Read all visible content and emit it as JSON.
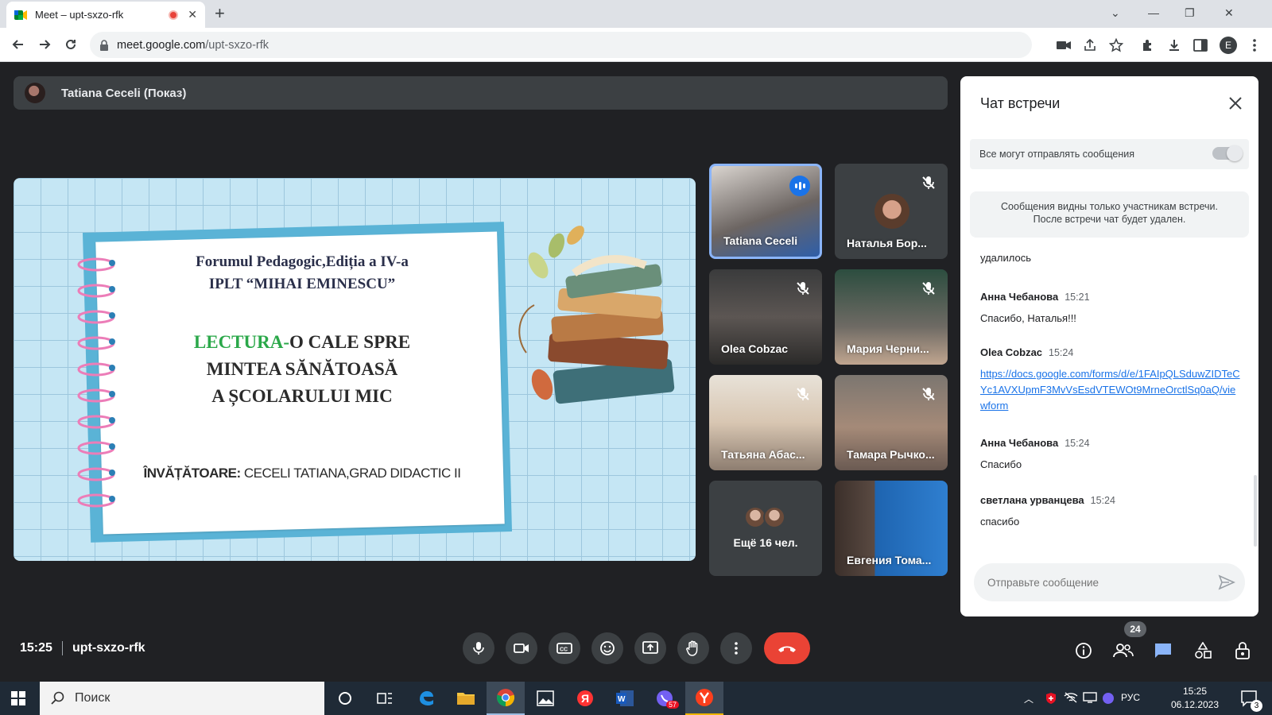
{
  "browser": {
    "tab_title": "Meet – upt-sxzo-rfk",
    "url_host": "meet.google.com",
    "url_path": "/upt-sxzo-rfk",
    "profile_initial": "E"
  },
  "meeting": {
    "presenter_label": "Tatiana Ceceli (Показ)",
    "time": "15:25",
    "code": "upt-sxzo-rfk",
    "participant_count": "24"
  },
  "slide": {
    "line1": "Forumul Pedagogic,Ediția a IV-a",
    "line2": "IPLT “MIHAI EMINESCU”",
    "title_green": "LECTURA-",
    "title_rest1": "O CALE SPRE",
    "title_line2": "MINTEA SĂNĂTOASĂ",
    "title_line3": "A ȘCOLARULUI MIC",
    "teacher_label": "ÎNVĂȚĂTOARE:",
    "teacher_name": "CECELI TATIANA,GRAD DIDACTIC II"
  },
  "participants": [
    {
      "name": "Tatiana Ceceli",
      "state": "speaking"
    },
    {
      "name": "Наталья Бор...",
      "state": "muted"
    },
    {
      "name": "Olea Cobzac",
      "state": "muted"
    },
    {
      "name": "Мария Черни...",
      "state": "muted"
    },
    {
      "name": "Татьяна Абас...",
      "state": "muted"
    },
    {
      "name": "Тамара Рычко...",
      "state": "muted"
    },
    {
      "name": "Ещё 16 чел.",
      "state": "overflow"
    },
    {
      "name": "Евгения Тома...",
      "state": "video"
    }
  ],
  "chat": {
    "title": "Чат встречи",
    "permission_label": "Все могут отправлять сообщения",
    "notice_line1": "Сообщения видны только участникам встречи.",
    "notice_line2": "После встречи чат будет удален.",
    "partial_text": "удалилось",
    "messages": [
      {
        "author": "Анна Чебанова",
        "time": "15:21",
        "text": "Спасибо, Наталья!!!"
      },
      {
        "author": "Olea Cobzac",
        "time": "15:24",
        "text": "https://docs.google.com/forms/d/e/1FAIpQLSduwZIDTeCYc1AVXUpmF3MvVsEsdVTEWOt9MrneOrctlSq0aQ/viewform"
      },
      {
        "author": "Анна Чебанова",
        "time": "15:24",
        "text": "Спасибо"
      },
      {
        "author": "светлана урванцева",
        "time": "15:24",
        "text": "спасибо"
      }
    ],
    "input_placeholder": "Отправьте сообщение"
  },
  "taskbar": {
    "search_placeholder": "Поиск",
    "language": "РУС",
    "time": "15:25",
    "date": "06.12.2023",
    "viber_badge": "57",
    "notification_count": "3"
  },
  "colors": {
    "meet_bg": "#202124",
    "end_call": "#ea4335",
    "link": "#1a73e8",
    "slide_green": "#2ba84a"
  }
}
